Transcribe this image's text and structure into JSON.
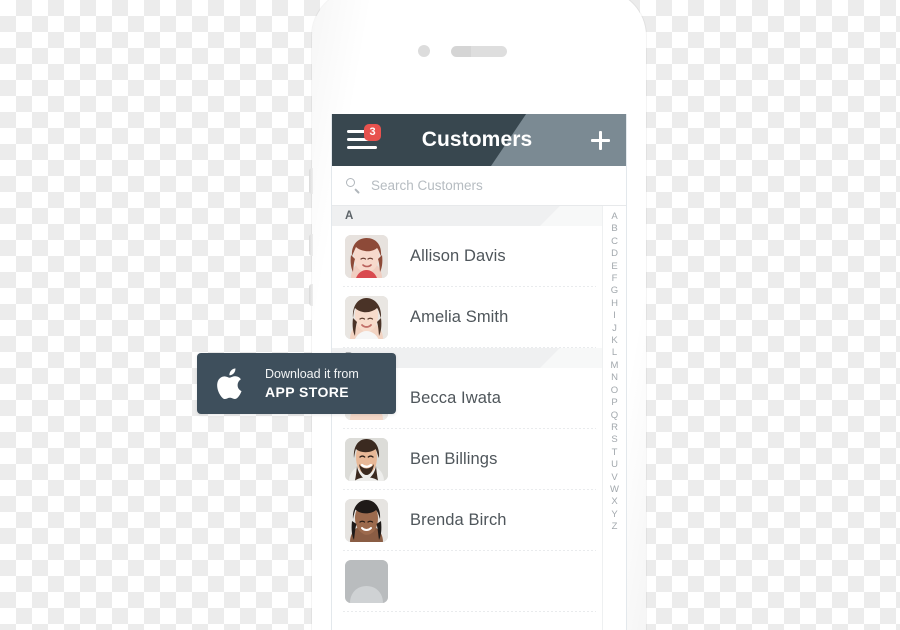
{
  "phone": {
    "camera_icon": "camera-dot",
    "speaker_icon": "earpiece-speaker"
  },
  "app": {
    "header": {
      "title": "Customers",
      "menu_icon": "hamburger-menu-icon",
      "menu_badge_count": "3",
      "add_icon": "plus-icon",
      "bg_dark": "#38474f",
      "bg_light": "#7b8a93",
      "badge_color": "#e8524e"
    },
    "search": {
      "icon": "search-icon",
      "placeholder": "Search Customers",
      "value": ""
    },
    "sections": [
      {
        "letter": "A",
        "rows": [
          {
            "name": "Allison Davis",
            "avatar": "woman-red-hair"
          },
          {
            "name": "Amelia Smith",
            "avatar": "woman-dark-hair"
          }
        ]
      },
      {
        "letter": "B",
        "rows": [
          {
            "name": "Becca Iwata",
            "avatar": "woman-light-hair"
          },
          {
            "name": "Ben Billings",
            "avatar": "man-beard"
          },
          {
            "name": "Brenda Birch",
            "avatar": "woman-black-hair"
          }
        ]
      }
    ],
    "alphabet_index": [
      "A",
      "B",
      "C",
      "D",
      "E",
      "F",
      "G",
      "H",
      "I",
      "J",
      "K",
      "L",
      "M",
      "N",
      "O",
      "P",
      "Q",
      "R",
      "S",
      "T",
      "U",
      "V",
      "W",
      "X",
      "Y",
      "Z"
    ]
  },
  "appstore_badge": {
    "icon": "apple-logo-icon",
    "line1": "Download it from",
    "line2": "APP STORE",
    "bg": "#3e4f5c"
  }
}
